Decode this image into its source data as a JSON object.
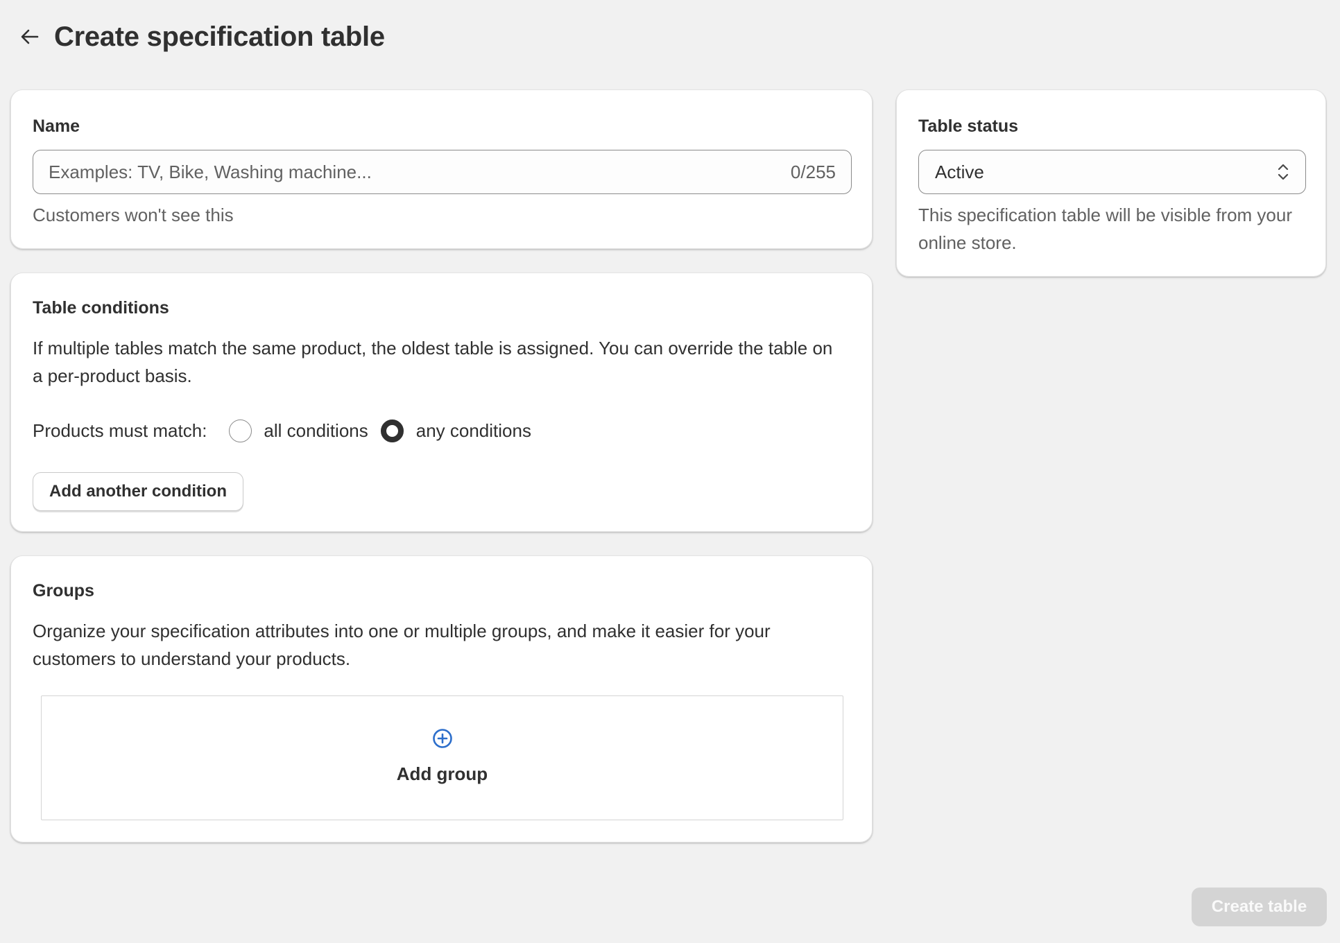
{
  "header": {
    "title": "Create specification table"
  },
  "name_card": {
    "title": "Name",
    "placeholder": "Examples: TV, Bike, Washing machine...",
    "value": "",
    "char_count": "0/255",
    "help": "Customers won't see this"
  },
  "status_card": {
    "title": "Table status",
    "selected": "Active",
    "help": "This specification table will be visible from your online store."
  },
  "conditions_card": {
    "title": "Table conditions",
    "description": "If multiple tables match the same product, the oldest table is assigned. You can override the table on a per-product basis.",
    "match_label": "Products must match:",
    "options": [
      {
        "label": "all conditions",
        "checked": false
      },
      {
        "label": "any conditions",
        "checked": true
      }
    ],
    "add_button": "Add another condition"
  },
  "groups_card": {
    "title": "Groups",
    "description": "Organize your specification attributes into one or multiple groups, and make it easier for your customers to understand your products.",
    "add_label": "Add group",
    "icon": "plus-circle-icon"
  },
  "footer": {
    "create_button": "Create table",
    "create_disabled": true
  },
  "colors": {
    "background": "#f1f1f1",
    "card": "#ffffff",
    "text": "#303030",
    "muted": "#616161",
    "accent": "#2c6ecb",
    "disabled_button": "#d4d4d4"
  }
}
